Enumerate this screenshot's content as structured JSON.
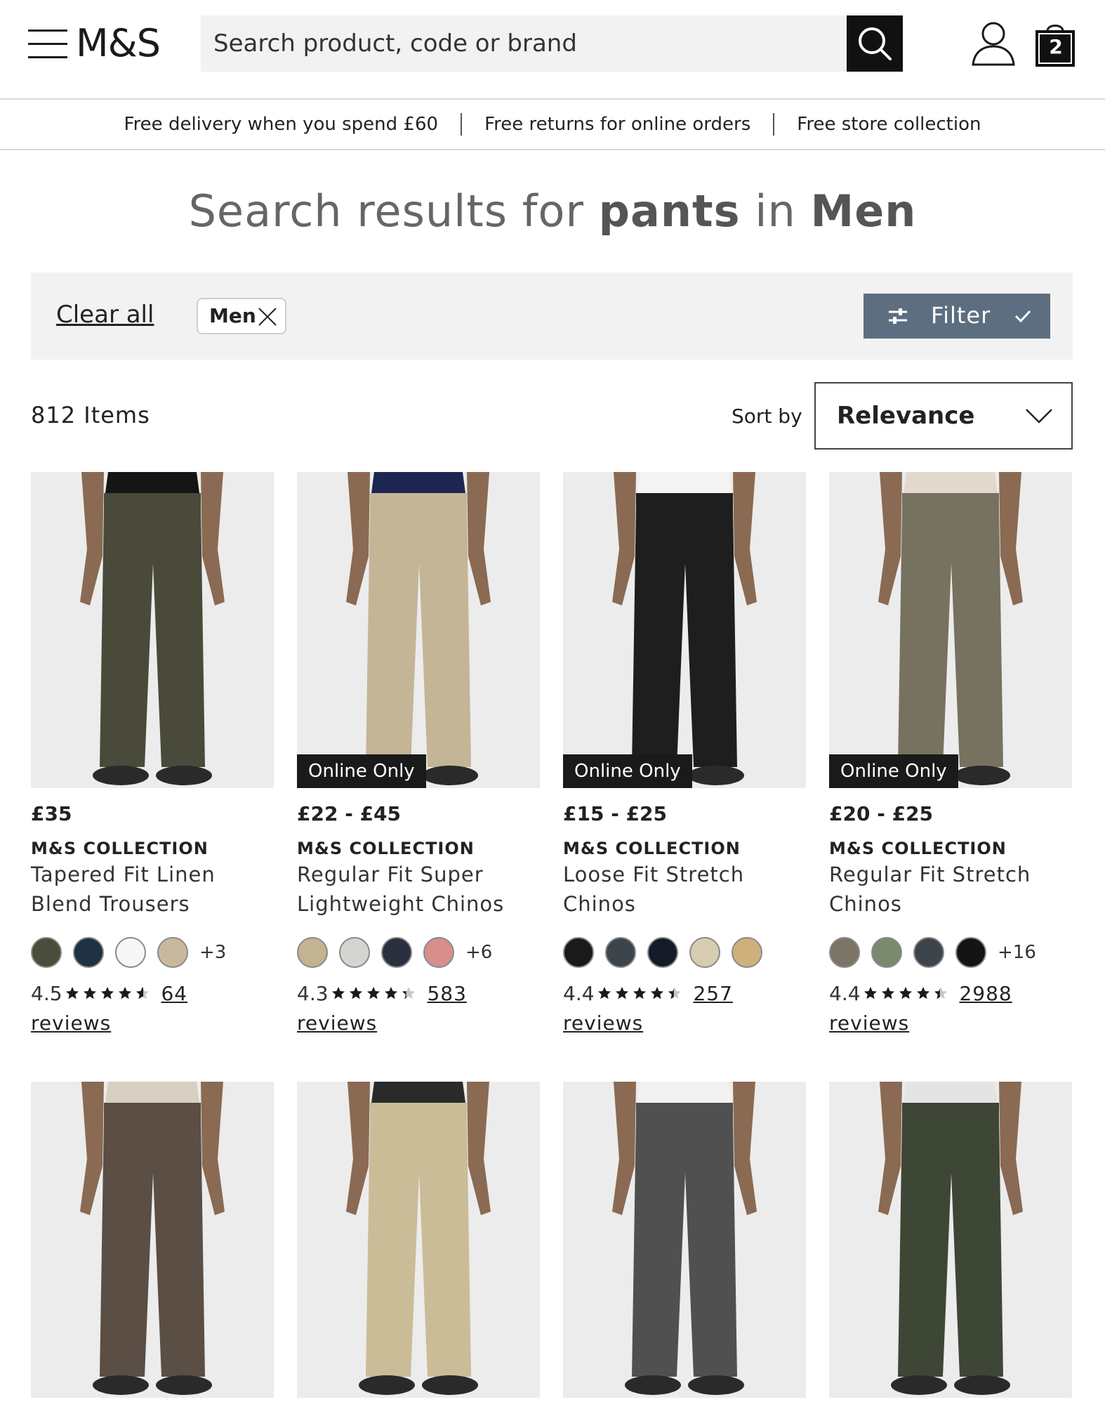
{
  "header": {
    "logo": "M&S",
    "search_placeholder": "Search product, code or brand",
    "bag_count": "2"
  },
  "promo": {
    "items": [
      "Free delivery when you spend £60",
      "Free returns for online orders",
      "Free store collection"
    ]
  },
  "results_title": {
    "prefix": "Search results for ",
    "query": "pants",
    "middle": " in ",
    "category": "Men"
  },
  "filter_bar": {
    "clear_all": "Clear all",
    "chip_label": "Men",
    "filter_label": "Filter"
  },
  "listing": {
    "items_count": "812 Items",
    "sort_label": "Sort by",
    "sort_value": "Relevance"
  },
  "products": [
    {
      "badge": "",
      "price": "£35",
      "brand": "M&S COLLECTION",
      "name": "Tapered Fit Linen Blend Trousers",
      "swatches": [
        "#4a4d3c",
        "#1f3142",
        "#f7f7f5",
        "#c9b99c"
      ],
      "more": "+3",
      "rating": "4.5",
      "reviews": "64 reviews",
      "pant_color": "#4a4a3b",
      "top_color": "#151515"
    },
    {
      "badge": "Online Only",
      "price": "£22 - £45",
      "brand": "M&S COLLECTION",
      "name": "Regular Fit Super Lightweight Chinos",
      "swatches": [
        "#c2b391",
        "#d6d4d0",
        "#2a3040",
        "#d98e8e"
      ],
      "more": "+6",
      "rating": "4.3",
      "reviews": "583 reviews",
      "pant_color": "#c4b597",
      "top_color": "#1c2650"
    },
    {
      "badge": "Online Only",
      "price": "£15 - £25",
      "brand": "M&S COLLECTION",
      "name": "Loose Fit Stretch Chinos",
      "swatches": [
        "#1a1a1a",
        "#3c444c",
        "#151a28",
        "#d6cdb0",
        "#cdb07c"
      ],
      "more": "",
      "rating": "4.4",
      "reviews": "257 reviews",
      "pant_color": "#1e1e1e",
      "top_color": "#f4f4f4"
    },
    {
      "badge": "Online Only",
      "price": "£20 - £25",
      "brand": "M&S COLLECTION",
      "name": "Regular Fit Stretch Chinos",
      "swatches": [
        "#7c7565",
        "#7b8a6c",
        "#3d444c",
        "#141414"
      ],
      "more": "+16",
      "rating": "4.4",
      "reviews": "2988 reviews",
      "pant_color": "#77715f",
      "top_color": "#e2d9cc"
    },
    {
      "pant_color": "#5a4e45",
      "top_color": "#d7cfc0"
    },
    {
      "pant_color": "#cbbc98",
      "top_color": "#2a2a2a"
    },
    {
      "pant_color": "#505050",
      "top_color": "#f2f2f2"
    },
    {
      "pant_color": "#3e4636",
      "top_color": "#e4e4e4"
    }
  ]
}
